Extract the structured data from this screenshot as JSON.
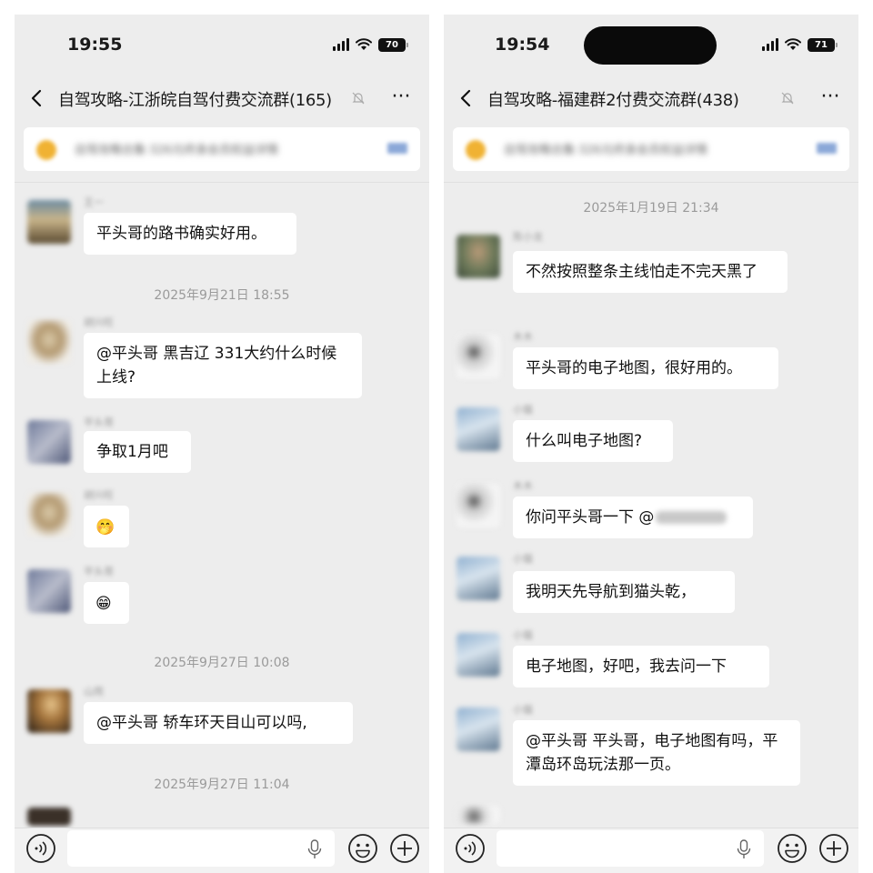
{
  "left": {
    "status": {
      "time": "19:55",
      "battery": "70"
    },
    "header": {
      "title": "自驾攻略-江浙皖自驾付费交流群(165)",
      "more": "···"
    },
    "pinned": {
      "text": "自驾攻略合集·326元终身会员权益详情"
    },
    "messages": {
      "m1": "平头哥的路书确实好用。",
      "t1": "2025年9月21日 18:55",
      "m2": "@平头哥 黑吉辽 331大约什么时候上线?",
      "m3": "争取1月吧",
      "m4_emoji": "🤭",
      "m5_emoji": "😁",
      "t2": "2025年9月27日 10:08",
      "m6": "@平头哥 轿车环天目山可以吗,",
      "t3": "2025年9月27日 11:04"
    }
  },
  "right": {
    "status": {
      "time": "19:54",
      "battery": "71"
    },
    "header": {
      "title": "自驾攻略-福建群2付费交流群(438)",
      "more": "···"
    },
    "pinned": {
      "text": "自驾攻略合集·326元终身会员权益详情"
    },
    "messages": {
      "t0": "2025年1月19日 21:34",
      "m1": "不然按照整条主线怕走不完天黑了",
      "m2": "平头哥的电子地图，很好用的。",
      "m3": "什么叫电子地图?",
      "m4": "你问平头哥一下 @",
      "m5": "我明天先导航到猫头乾，",
      "m6": "电子地图，好吧，我去问一下",
      "m7": "@平头哥 平头哥，电子地图有吗，平潭岛环岛玩法那一页。"
    }
  },
  "icons": {
    "back": "chevron-left-icon",
    "mute": "bell-mute-icon",
    "more": "more-icon",
    "voice": "voice-icon",
    "mic": "mic-icon",
    "emoji": "emoji-icon",
    "plus": "plus-icon"
  }
}
